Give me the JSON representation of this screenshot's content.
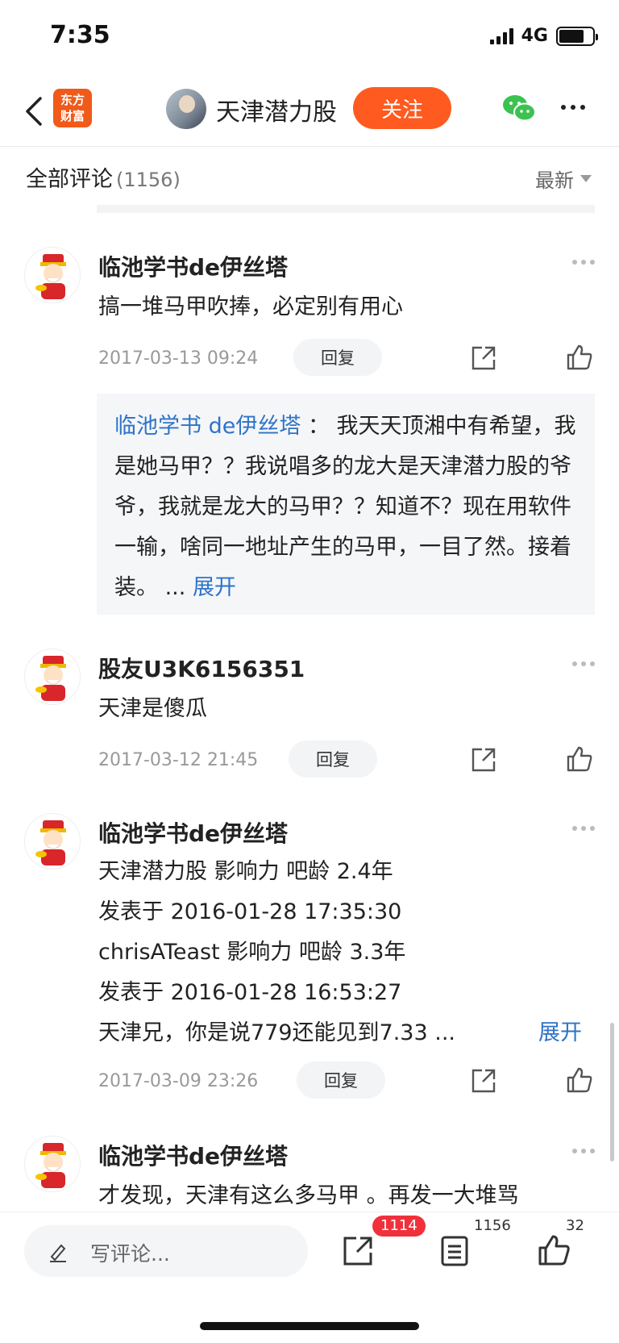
{
  "status": {
    "time": "7:35",
    "network": "4G",
    "battery_level": 0.75
  },
  "nav": {
    "logo_line1": "东方",
    "logo_line2": "财富",
    "title": "天津潜力股",
    "follow_label": "关注"
  },
  "comments_header": {
    "title": "全部评论",
    "count": "(1156)",
    "sort_label": "最新"
  },
  "comments": [
    {
      "name": "临池学书de伊丝塔",
      "text": "搞一堆马甲吹捧，必定别有用心",
      "time": "2017-03-13 09:24",
      "reply_label": "回复",
      "quote_name": "临池学书 de伊丝塔",
      "quote_sep": "：",
      "quote_text": "我天天顶湘中有希望，我是她马甲？？我说唱多的龙大是天津潜力股的爷爷，我就是龙大的马甲？？知道不？现在用软件一输，啥同一地址产生的马甲，一目了然。接着装。 ...",
      "quote_expand": "展开"
    },
    {
      "name": "股友U3K6156351",
      "text": "天津是傻瓜",
      "time": "2017-03-12 21:45",
      "reply_label": "回复"
    },
    {
      "name": "临池学书de伊丝塔",
      "lines": [
        "天津潜力股 影响力  吧龄 2.4年",
        "发表于 2016-01-28 17:35:30",
        "chrisATeast 影响力  吧龄 3.3年",
        "发表于 2016-01-28 16:53:27",
        "天津兄，你是说779还能见到7.33 ..."
      ],
      "expand": "展开",
      "time": "2017-03-09 23:26",
      "reply_label": "回复"
    },
    {
      "name": "临池学书de伊丝塔",
      "text": "才发现，天津有这么多马甲 。再发一大堆骂"
    }
  ],
  "bottom": {
    "compose_placeholder": "写评论...",
    "share_badge": "1114",
    "comment_count": "1156",
    "like_count": "32"
  }
}
